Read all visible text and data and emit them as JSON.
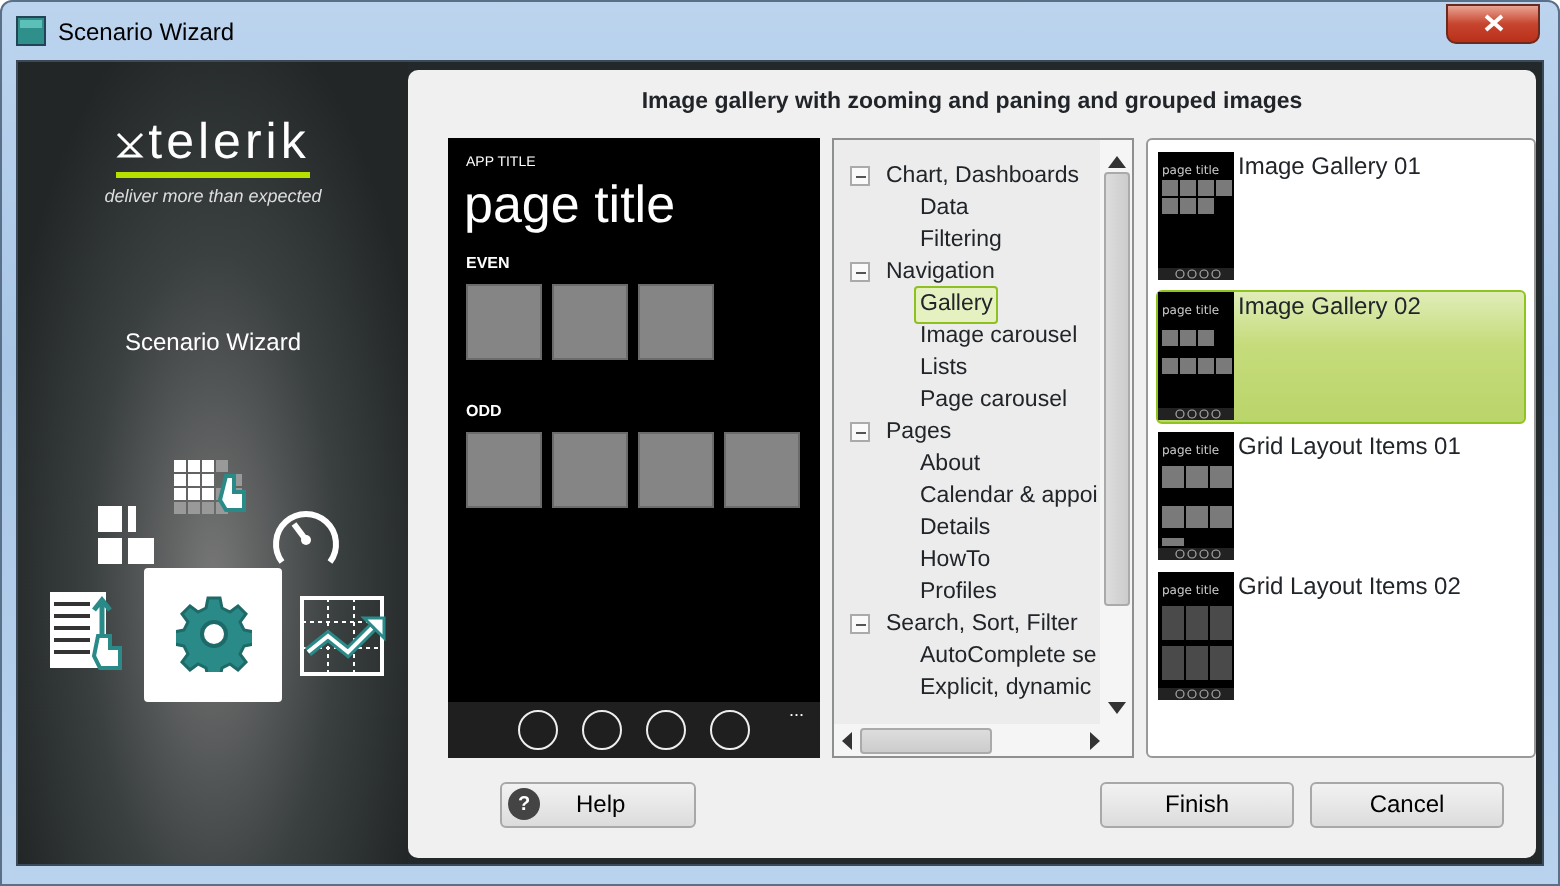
{
  "window": {
    "title": "Scenario Wizard"
  },
  "brand": {
    "logo": "telerik",
    "tagline": "deliver more than expected",
    "caption": "Scenario Wizard"
  },
  "heading": "Image gallery with zooming and paning and grouped images",
  "preview": {
    "app_title": "APP TITLE",
    "page_title": "page title",
    "groups": [
      {
        "label": "EVEN",
        "tiles": [
          {
            "kind": "tile"
          },
          {
            "kind": "tile"
          },
          {
            "kind": "tile"
          }
        ]
      },
      {
        "label": "ODD",
        "tiles": [
          {
            "kind": "tile"
          },
          {
            "kind": "tile"
          },
          {
            "kind": "tile"
          },
          {
            "kind": "tile"
          }
        ]
      }
    ],
    "app_bar": {
      "buttons": [
        {
          "kind": "circle"
        },
        {
          "kind": "circle"
        },
        {
          "kind": "circle"
        },
        {
          "kind": "circle"
        }
      ],
      "more": "..."
    }
  },
  "tree": [
    {
      "label": "Chart, Dashboards",
      "expanded": true,
      "children": [
        {
          "label": "Data",
          "selected": false
        },
        {
          "label": "Filtering",
          "selected": false
        }
      ]
    },
    {
      "label": "Navigation",
      "expanded": true,
      "children": [
        {
          "label": "Gallery",
          "selected": true
        },
        {
          "label": "Image carousel",
          "selected": false
        },
        {
          "label": "Lists",
          "selected": false
        },
        {
          "label": "Page carousel",
          "selected": false
        }
      ]
    },
    {
      "label": "Pages",
      "expanded": true,
      "children": [
        {
          "label": "About",
          "selected": false
        },
        {
          "label": "Calendar & appoi",
          "selected": false
        },
        {
          "label": "Details",
          "selected": false
        },
        {
          "label": "HowTo",
          "selected": false
        },
        {
          "label": "Profiles",
          "selected": false
        }
      ]
    },
    {
      "label": "Search, Sort, Filter",
      "expanded": true,
      "children": [
        {
          "label": "AutoComplete se",
          "selected": false
        },
        {
          "label": "Explicit, dynamic",
          "selected": false
        }
      ]
    }
  ],
  "templates": [
    {
      "name": "Image Gallery 01",
      "thumb_title": "page title",
      "kind": "gallery",
      "selected": false
    },
    {
      "name": "Image Gallery 02",
      "thumb_title": "page title",
      "kind": "grouped",
      "selected": true
    },
    {
      "name": "Grid Layout Items 01",
      "thumb_title": "page title",
      "kind": "captioned",
      "selected": false
    },
    {
      "name": "Grid Layout Items 02",
      "thumb_title": "page title",
      "kind": "grid",
      "selected": false
    }
  ],
  "buttons": {
    "help": "Help",
    "help_icon": "?",
    "finish": "Finish",
    "cancel": "Cancel"
  }
}
